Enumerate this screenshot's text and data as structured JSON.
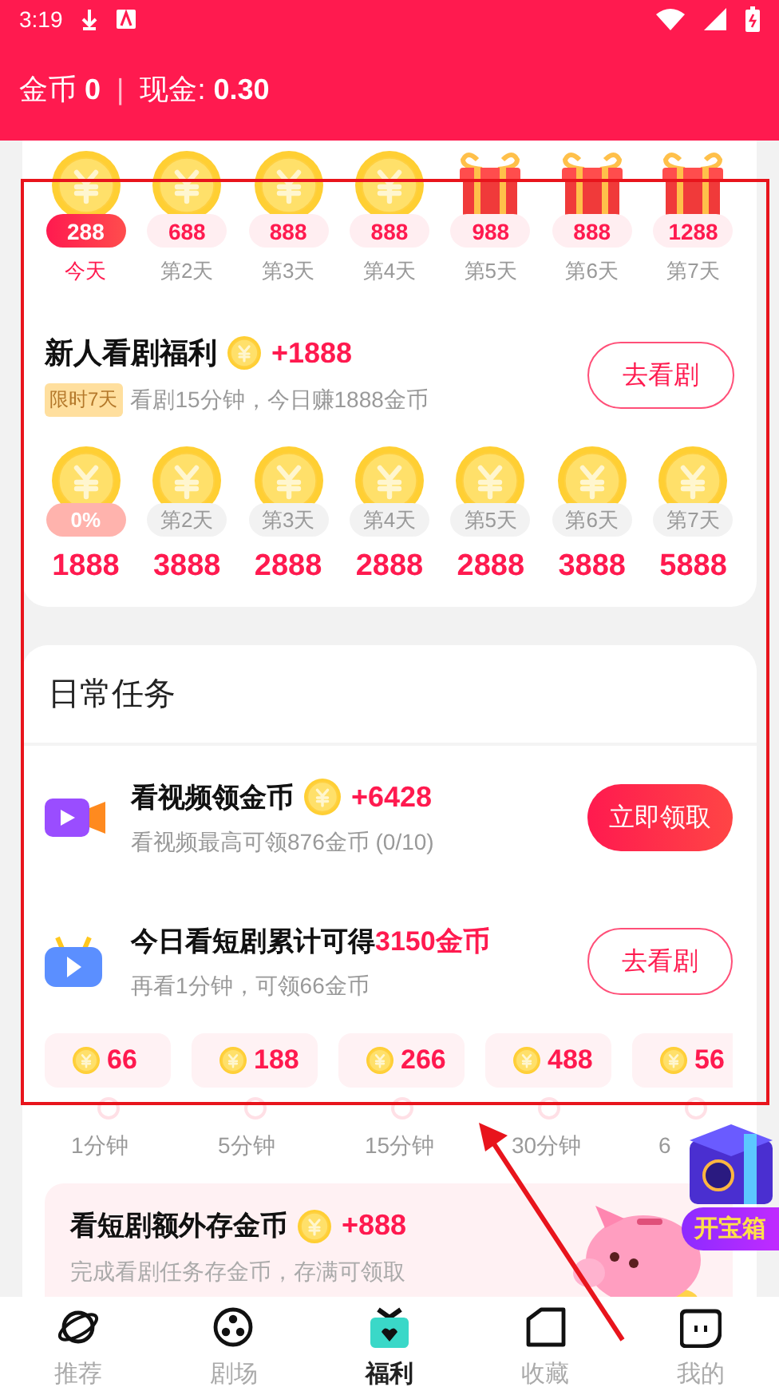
{
  "status_bar": {
    "time": "3:19"
  },
  "header": {
    "coins": "金币 **0**",
    "separator": "|",
    "cash": "现金: **0.30**"
  },
  "checkin": {
    "days": [
      {
        "kind": "coin",
        "amount": "288",
        "label": "今天",
        "selected": true
      },
      {
        "kind": "coin",
        "amount": "688",
        "label": "第2天",
        "selected": false
      },
      {
        "kind": "coin",
        "amount": "888",
        "label": "第3天",
        "selected": false
      },
      {
        "kind": "coin",
        "amount": "888",
        "label": "第4天",
        "selected": false
      },
      {
        "kind": "gift",
        "amount": "988",
        "label": "第5天",
        "selected": false
      },
      {
        "kind": "gift",
        "amount": "888",
        "label": "第6天",
        "selected": false
      },
      {
        "kind": "gift",
        "amount": "1288",
        "label": "第7天",
        "selected": false
      }
    ]
  },
  "newbie": {
    "title": "新人看剧福利",
    "bonus": "+1888",
    "tag": "限时7天",
    "subtitle": "看剧15分钟，今日赚1888金币",
    "button": "去看剧",
    "days": [
      {
        "kind": "progress",
        "badge": "0%",
        "amount": "1888"
      },
      {
        "kind": "day",
        "badge": "第2天",
        "amount": "3888"
      },
      {
        "kind": "day",
        "badge": "第3天",
        "amount": "2888"
      },
      {
        "kind": "day",
        "badge": "第4天",
        "amount": "2888"
      },
      {
        "kind": "day",
        "badge": "第5天",
        "amount": "2888"
      },
      {
        "kind": "day",
        "badge": "第6天",
        "amount": "3888"
      },
      {
        "kind": "day",
        "badge": "第7天",
        "amount": "5888"
      }
    ]
  },
  "daily": {
    "title": "日常任务",
    "tasks": [
      {
        "kind": "video",
        "title": "看视频领金币",
        "bonus": "+6428",
        "subtitle": "看视频最高可领876金币 (0/10)",
        "button": "立即领取",
        "primary": true
      },
      {
        "kind": "tv",
        "title": "今日看短剧累计可得",
        "highlight": "3150金币",
        "subtitle": "再看1分钟，可领66金币",
        "button": "去看剧",
        "primary": false
      }
    ],
    "milestones": [
      {
        "amount": "66",
        "time": "1分钟"
      },
      {
        "amount": "188",
        "time": "5分钟"
      },
      {
        "amount": "266",
        "time": "15分钟"
      },
      {
        "amount": "488",
        "time": "30分钟"
      },
      {
        "amount": "56",
        "time": "6"
      }
    ]
  },
  "savings": {
    "title": "看短剧额外存金币",
    "bonus": "+888",
    "subtitle": "完成看剧任务存金币，存满可领取"
  },
  "treasure": {
    "label": "开宝箱"
  },
  "nav": [
    {
      "kind": "planet",
      "label": "推荐",
      "selected": false
    },
    {
      "kind": "reel",
      "label": "剧场",
      "selected": false
    },
    {
      "kind": "gift",
      "label": "福利",
      "selected": true
    },
    {
      "kind": "folder",
      "label": "收藏",
      "selected": false
    },
    {
      "kind": "chat",
      "label": "我的",
      "selected": false
    }
  ]
}
